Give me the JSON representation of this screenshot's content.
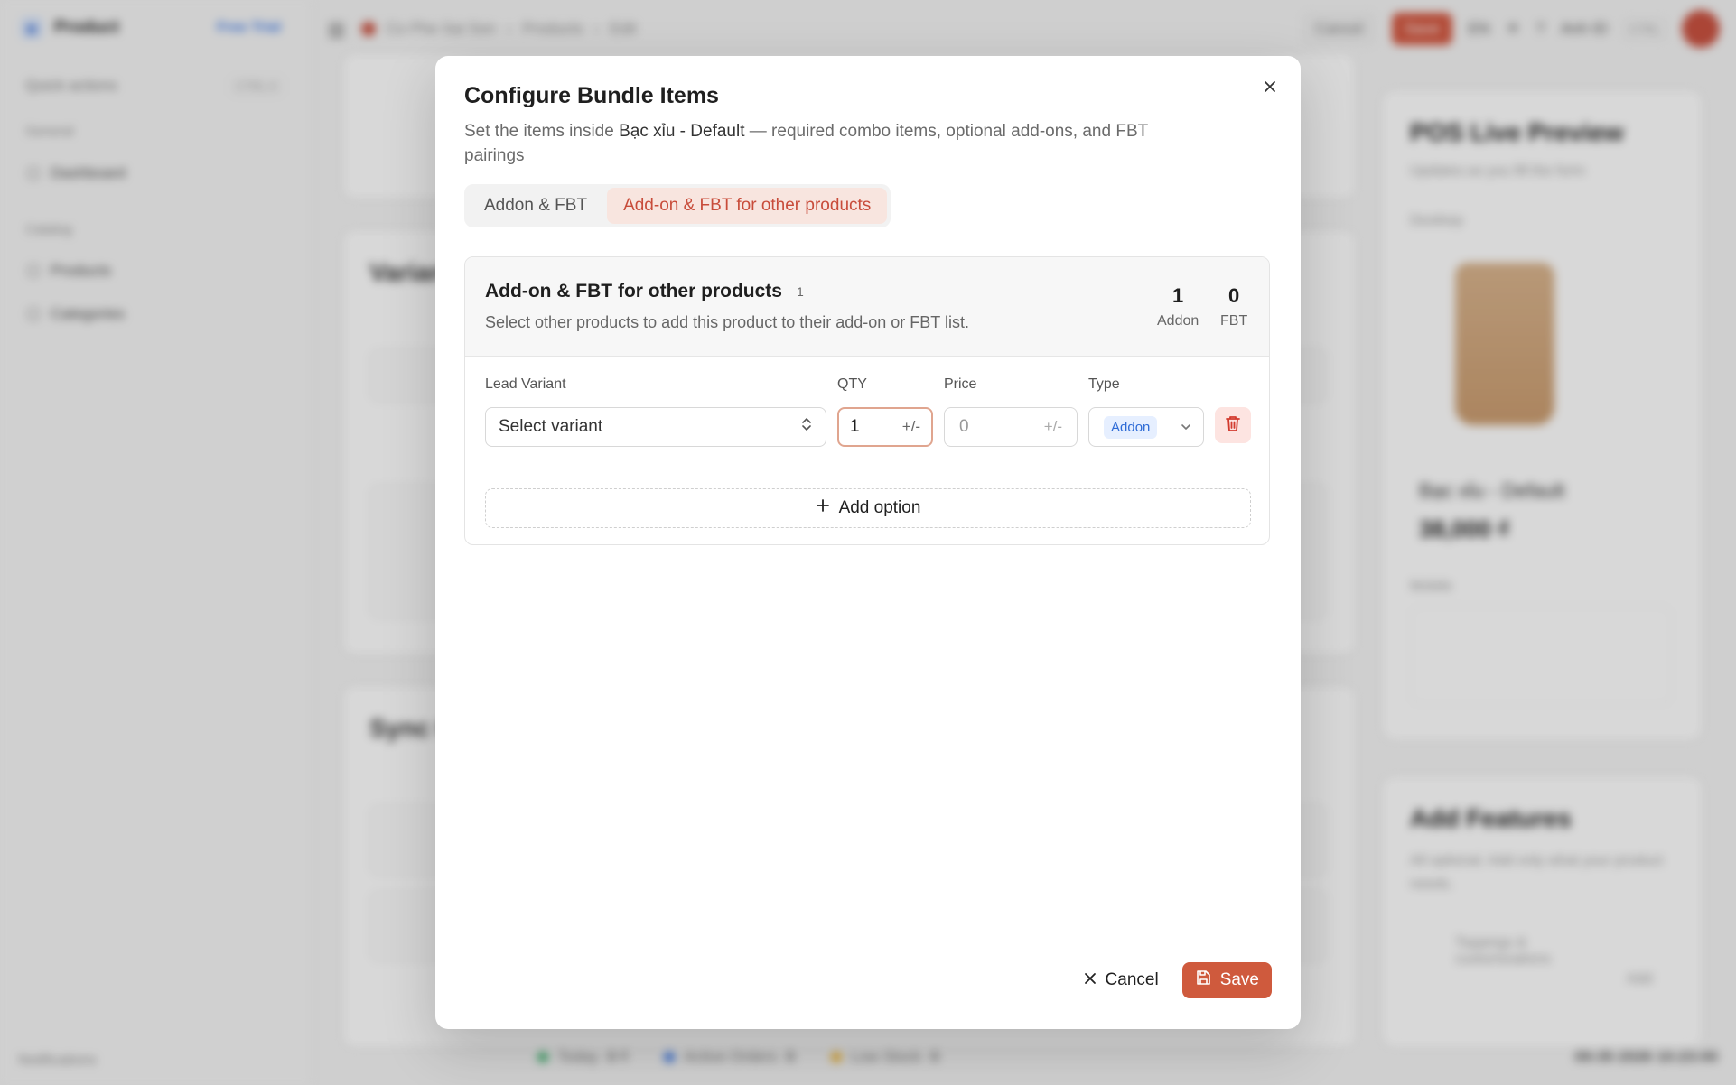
{
  "background": {
    "sidebar": {
      "brand": "Product",
      "free_trial": "Free Trial",
      "quick_actions": "Quick actions",
      "quick_actions_kbd": "CTRL K",
      "groups": [
        "General",
        "Catalog"
      ],
      "items": [
        "Dashboard",
        "Products",
        "Categories"
      ],
      "notifications": "Notifications"
    },
    "topbar": {
      "breadcrumb": [
        "Co Phe Sai Son",
        "Products",
        "Edit"
      ],
      "cancel": "Cancel",
      "save": "Save",
      "lang": "EN",
      "user": "Anh ID",
      "user_kbd": "CTRL"
    },
    "main": {
      "variants_title": "Varian",
      "sync_title": "Sync t"
    },
    "pos_preview": {
      "title": "POS Live Preview",
      "subtitle": "Updates as you fill the form",
      "section_desktop": "Desktop",
      "section_mobile": "Mobile",
      "product_name": "Bạc xỉu - Default",
      "price": "38,000 ₫"
    },
    "add_features": {
      "title": "Add Features",
      "subtitle": "All optional. Add only what your product needs.",
      "item": "Toppings & customizations",
      "item_action": "Add"
    },
    "statusbar": {
      "today": "Today",
      "today_value": "0 ₫",
      "active_orders": "Active Orders",
      "active_orders_value": "0",
      "low_stock": "Low Stock",
      "low_stock_value": "0",
      "clock": "09:35 2026 10:23:00"
    }
  },
  "modal": {
    "title": "Configure Bundle Items",
    "desc_prefix": "Set the items inside ",
    "desc_product": "Bạc xỉu - Default",
    "desc_suffix": " — required combo items, optional add-ons, and FBT pairings",
    "tabs": [
      {
        "label": "Addon & FBT",
        "active": false
      },
      {
        "label": "Add-on & FBT for other products",
        "active": true
      }
    ],
    "panel": {
      "title": "Add-on & FBT for other products",
      "count": "1",
      "subtitle": "Select other products to add this product to their add-on or FBT list.",
      "stats": [
        {
          "value": "1",
          "label": "Addon"
        },
        {
          "value": "0",
          "label": "FBT"
        }
      ],
      "columns": {
        "lead_variant": "Lead Variant",
        "qty": "QTY",
        "price": "Price",
        "type": "Type"
      },
      "row": {
        "variant_placeholder": "Select variant",
        "qty": "1",
        "qty_suffix": "+/-",
        "price": "0",
        "price_suffix": "+/-",
        "type": "Addon"
      },
      "add_option": "Add option"
    },
    "footer": {
      "cancel": "Cancel",
      "save": "Save"
    }
  },
  "colors": {
    "accent": "#cf5a3d",
    "tab_active_bg": "#f8e5df",
    "badge_blue": "#2e6bd6",
    "delete_bg": "#fde4e1",
    "delete_icon": "#d23b2f"
  }
}
